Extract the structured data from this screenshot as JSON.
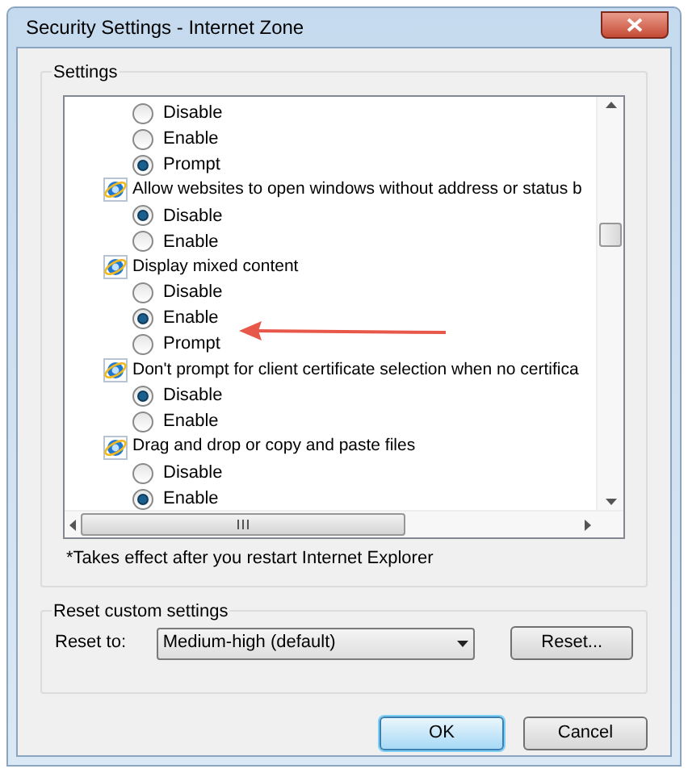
{
  "window": {
    "title": "Security Settings - Internet Zone"
  },
  "settings": {
    "title": "Settings",
    "items": [
      {
        "kind": "option",
        "label": "Disable",
        "selected": false
      },
      {
        "kind": "option",
        "label": "Enable",
        "selected": false
      },
      {
        "kind": "option",
        "label": "Prompt",
        "selected": true
      },
      {
        "kind": "setting",
        "label": "Allow websites to open windows without address or status b"
      },
      {
        "kind": "option",
        "label": "Disable",
        "selected": true
      },
      {
        "kind": "option",
        "label": "Enable",
        "selected": false
      },
      {
        "kind": "setting",
        "label": "Display mixed content"
      },
      {
        "kind": "option",
        "label": "Disable",
        "selected": false
      },
      {
        "kind": "option",
        "label": "Enable",
        "selected": true
      },
      {
        "kind": "option",
        "label": "Prompt",
        "selected": false
      },
      {
        "kind": "setting",
        "label": "Don't prompt for client certificate selection when no certifica"
      },
      {
        "kind": "option",
        "label": "Disable",
        "selected": true
      },
      {
        "kind": "option",
        "label": "Enable",
        "selected": false
      },
      {
        "kind": "setting",
        "label": "Drag and drop or copy and paste files"
      },
      {
        "kind": "option",
        "label": "Disable",
        "selected": false
      },
      {
        "kind": "option",
        "label": "Enable",
        "selected": true
      }
    ],
    "note": "*Takes effect after you restart Internet Explorer"
  },
  "reset": {
    "title": "Reset custom settings",
    "label": "Reset to:",
    "value": "Medium-high (default)",
    "button": "Reset..."
  },
  "buttons": [
    {
      "label": "OK",
      "kind": "default"
    },
    {
      "label": "Cancel",
      "kind": "normal"
    }
  ]
}
